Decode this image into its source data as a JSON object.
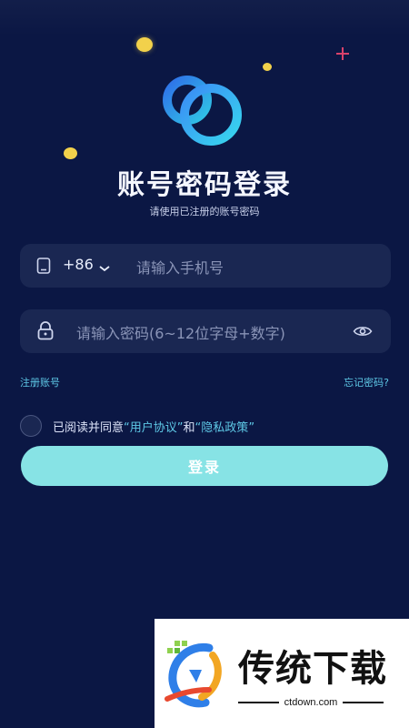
{
  "header": {
    "title": "账号密码登录",
    "subtitle": "请使用已注册的账号密码"
  },
  "phone_field": {
    "country_code": "+86",
    "placeholder": "请输入手机号",
    "icon": "phone-icon"
  },
  "password_field": {
    "placeholder": "请输入密码(6~12位字母+数字)",
    "lock_icon": "lock-icon",
    "visibility_icon": "eye-icon"
  },
  "links": {
    "register": "注册账号",
    "forgot": "忘记密码?"
  },
  "agreement": {
    "prefix": "已阅读并同意",
    "open_quote1": "“",
    "user_agreement": "用户协议",
    "close_quote1": "”",
    "and": "和",
    "open_quote2": "“",
    "privacy_policy": "隐私政策",
    "close_quote2": "”"
  },
  "login_button": "登录",
  "watermark": {
    "brand": "传统下载",
    "url": "ctdown.com"
  },
  "colors": {
    "background": "#0b1744",
    "field": "#1a2752",
    "accent_link": "#5ec8e6",
    "login_button": "#87e3e5"
  }
}
